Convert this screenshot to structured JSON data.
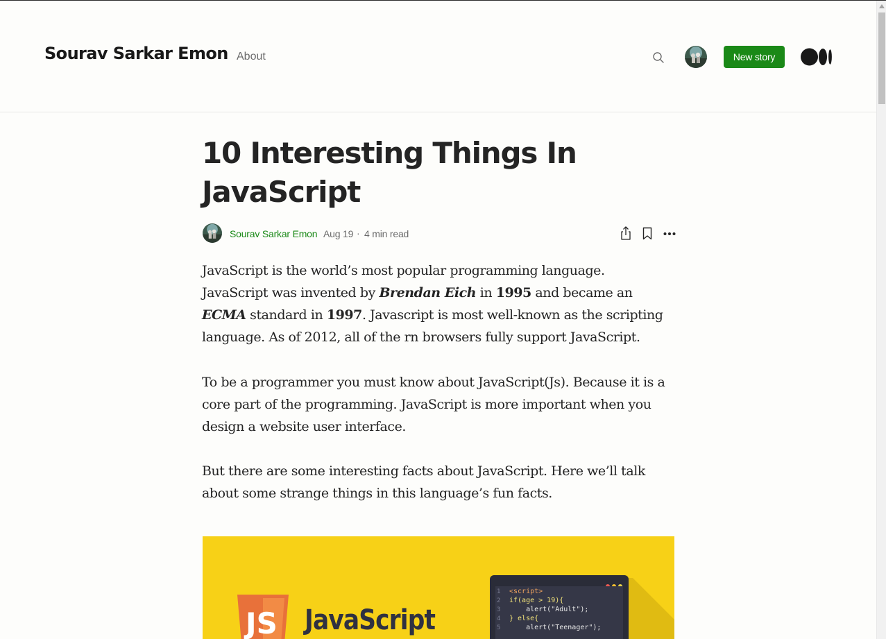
{
  "header": {
    "brand": "Sourav Sarkar Emon",
    "about": "About",
    "new_story": "New story"
  },
  "article": {
    "title": "10 Interesting Things In JavaScript",
    "author": "Sourav Sarkar Emon",
    "date": "Aug 19",
    "separator": "·",
    "read_time": "4 min read",
    "p1": {
      "a": "JavaScript is the world’s most popular programming language. JavaScript was invented by ",
      "b": "Brendan Eich",
      "c": " in ",
      "d": "1995",
      "e": " and became an ",
      "f": "ECMA",
      "g": " standard in ",
      "h": "1997",
      "i": ". Javascript is most well-known as the scripting language. As of 2012, all of the rn browsers fully support JavaScript."
    },
    "p2": "To be a programmer you must know about JavaScript(Js). Because it is a core part of the programming. JavaScript is more important when you design a website user interface.",
    "p3": "But there are some interesting facts about JavaScript. Here we’ll talk about some strange things in this language’s fun facts."
  },
  "hero": {
    "logo_text": "JS",
    "word": "JavaScript",
    "code": [
      "<script>",
      "if(age > 19){",
      "    alert(\"Adult\");",
      "} else{",
      "    alert(\"Teenager\");"
    ],
    "line_numbers": [
      "1",
      "2",
      "3",
      "4",
      "5"
    ]
  },
  "icons": {
    "search": "search-icon",
    "share": "share-icon",
    "bookmark": "bookmark-icon",
    "more": "more-icon",
    "logo": "medium-logo-icon"
  },
  "colors": {
    "accent": "#1a8917",
    "hero_bg": "#f7d117",
    "text": "#242424",
    "muted": "#6b6b6b"
  }
}
